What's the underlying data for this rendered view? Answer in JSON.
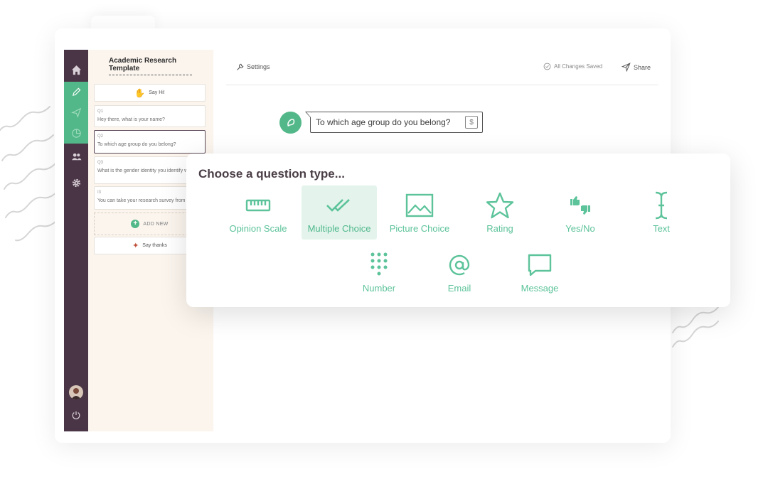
{
  "sidebar": {
    "title": "Academic Research Template",
    "say_hi": "Say Hi!",
    "questions": [
      {
        "no": "Q1",
        "text": "Hey there, what is your name?"
      },
      {
        "no": "Q2",
        "text": "To which age group do you belong?"
      },
      {
        "no": "Q3",
        "text": "What is the gender identity you identify with?"
      },
      {
        "no": "I3",
        "text": "You can take your research survey from"
      }
    ],
    "add_new": "ADD NEW",
    "say_thanks": "Say thanks"
  },
  "topbar": {
    "settings": "Settings",
    "saved": "All Changes Saved",
    "share": "Share"
  },
  "question": {
    "text": "To which age group do you belong?",
    "variable_icon": "$"
  },
  "popup": {
    "title": "Choose a question type...",
    "types": [
      {
        "label": "Opinion Scale",
        "icon": "ruler-icon"
      },
      {
        "label": "Multiple Choice",
        "icon": "double-check-icon"
      },
      {
        "label": "Picture Choice",
        "icon": "image-icon"
      },
      {
        "label": "Rating",
        "icon": "star-icon"
      },
      {
        "label": "Yes/No",
        "icon": "thumbs-icon"
      },
      {
        "label": "Text",
        "icon": "text-cursor-icon"
      },
      {
        "label": "Number",
        "icon": "keypad-icon"
      },
      {
        "label": "Email",
        "icon": "at-icon"
      },
      {
        "label": "Message",
        "icon": "message-icon"
      }
    ]
  },
  "colors": {
    "rail": "#4a3547",
    "accent": "#53b889",
    "sidebar_bg": "#fbf5ee",
    "popup_active": "#e4f4ec"
  }
}
